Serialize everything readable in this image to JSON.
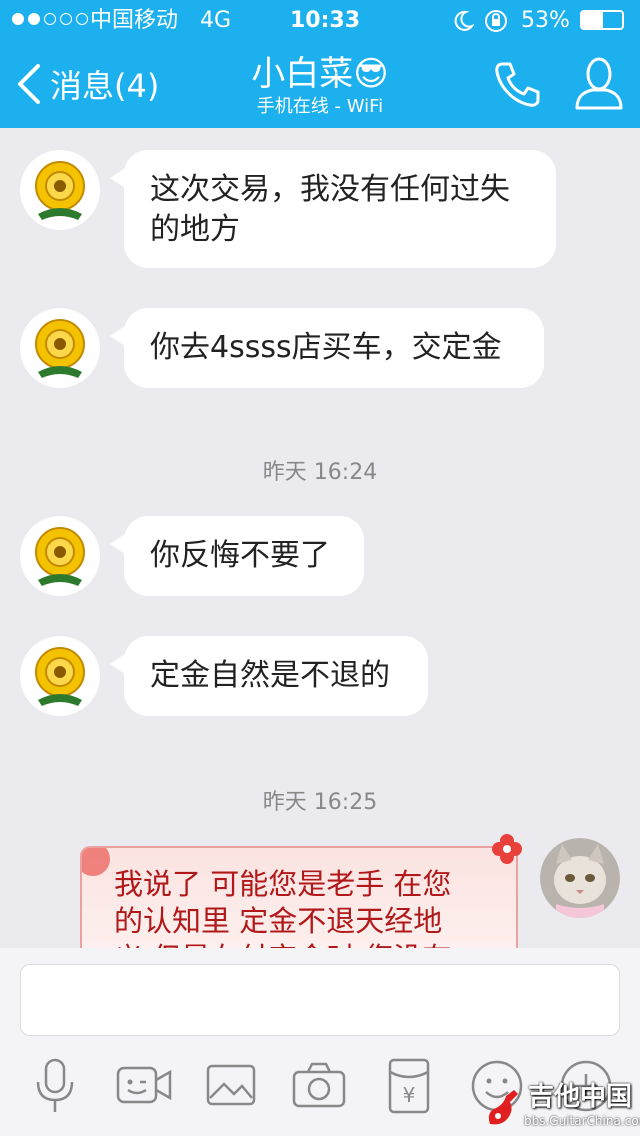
{
  "status_bar": {
    "carrier": "中国移动",
    "network": "4G",
    "time": "10:33",
    "battery": "53%"
  },
  "nav": {
    "back_label": "消息(4)",
    "contact_name": "小白菜",
    "contact_emoji": "😎",
    "status": "手机在线 - WiFi"
  },
  "messages": [
    {
      "side": "left",
      "text_line1": "这次交易，我没有任何过失",
      "text_line2": "的地方"
    },
    {
      "side": "left",
      "text": "你去4ssss店买车，交定金"
    },
    {
      "timestamp": "昨天 16:24"
    },
    {
      "side": "left",
      "text": "你反悔不要了"
    },
    {
      "side": "left",
      "text": "定金自然是不退的"
    },
    {
      "timestamp": "昨天 16:25"
    },
    {
      "side": "right",
      "text_line1": "我说了 可能您是老手 在您",
      "text_line2": "的认知里 定金不退天经地",
      "text_line3": "义 但是在付定金时 您没有"
    }
  ],
  "watermark": {
    "brand": "吉他中国",
    "url": "bbs.GuitarChina.com"
  },
  "colors": {
    "accent": "#1cb0ef",
    "bubble_bg": "#ffffff",
    "page_bg": "#ebebef",
    "right_bubble_bg": "#fdeceb",
    "right_text": "#b0181a"
  },
  "toolbar_icons": [
    "microphone-icon",
    "video-icon",
    "image-icon",
    "camera-icon",
    "red-packet-icon",
    "emoji-icon",
    "plus-icon"
  ]
}
